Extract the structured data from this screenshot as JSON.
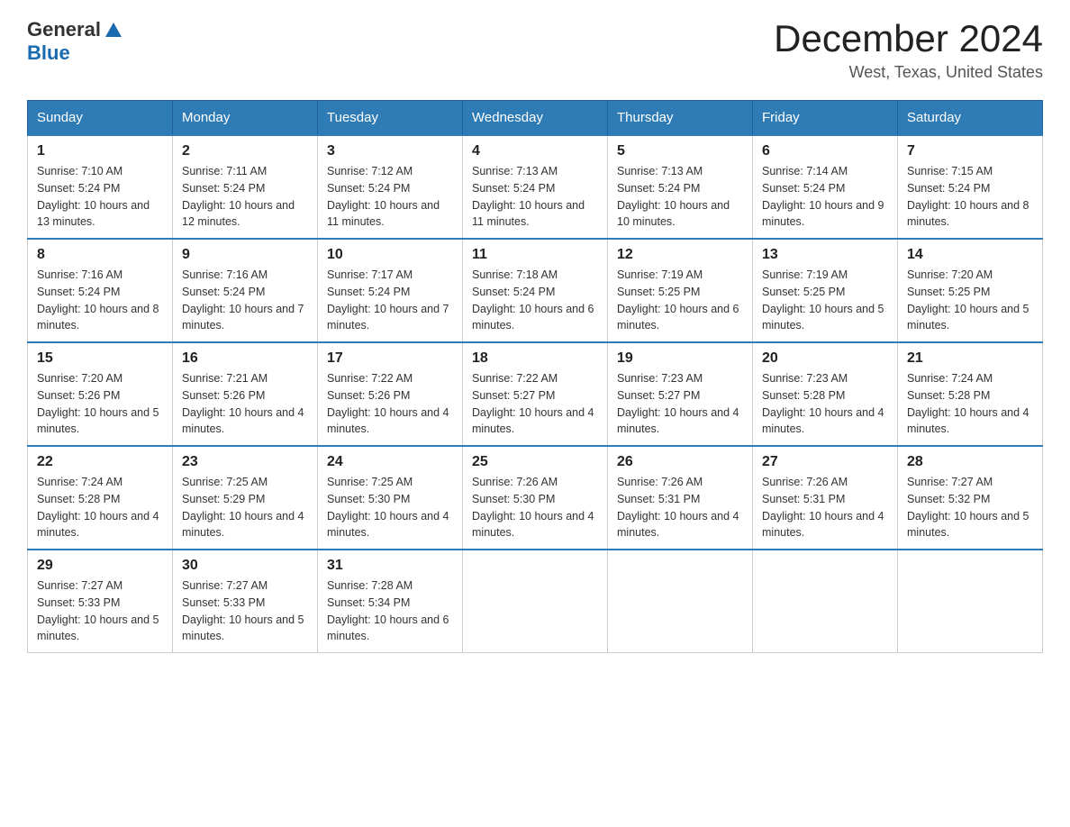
{
  "header": {
    "logo": {
      "general": "General",
      "blue": "Blue"
    },
    "title": "December 2024",
    "subtitle": "West, Texas, United States"
  },
  "weekdays": [
    "Sunday",
    "Monday",
    "Tuesday",
    "Wednesday",
    "Thursday",
    "Friday",
    "Saturday"
  ],
  "weeks": [
    [
      {
        "day": "1",
        "sunrise": "7:10 AM",
        "sunset": "5:24 PM",
        "daylight": "10 hours and 13 minutes."
      },
      {
        "day": "2",
        "sunrise": "7:11 AM",
        "sunset": "5:24 PM",
        "daylight": "10 hours and 12 minutes."
      },
      {
        "day": "3",
        "sunrise": "7:12 AM",
        "sunset": "5:24 PM",
        "daylight": "10 hours and 11 minutes."
      },
      {
        "day": "4",
        "sunrise": "7:13 AM",
        "sunset": "5:24 PM",
        "daylight": "10 hours and 11 minutes."
      },
      {
        "day": "5",
        "sunrise": "7:13 AM",
        "sunset": "5:24 PM",
        "daylight": "10 hours and 10 minutes."
      },
      {
        "day": "6",
        "sunrise": "7:14 AM",
        "sunset": "5:24 PM",
        "daylight": "10 hours and 9 minutes."
      },
      {
        "day": "7",
        "sunrise": "7:15 AM",
        "sunset": "5:24 PM",
        "daylight": "10 hours and 8 minutes."
      }
    ],
    [
      {
        "day": "8",
        "sunrise": "7:16 AM",
        "sunset": "5:24 PM",
        "daylight": "10 hours and 8 minutes."
      },
      {
        "day": "9",
        "sunrise": "7:16 AM",
        "sunset": "5:24 PM",
        "daylight": "10 hours and 7 minutes."
      },
      {
        "day": "10",
        "sunrise": "7:17 AM",
        "sunset": "5:24 PM",
        "daylight": "10 hours and 7 minutes."
      },
      {
        "day": "11",
        "sunrise": "7:18 AM",
        "sunset": "5:24 PM",
        "daylight": "10 hours and 6 minutes."
      },
      {
        "day": "12",
        "sunrise": "7:19 AM",
        "sunset": "5:25 PM",
        "daylight": "10 hours and 6 minutes."
      },
      {
        "day": "13",
        "sunrise": "7:19 AM",
        "sunset": "5:25 PM",
        "daylight": "10 hours and 5 minutes."
      },
      {
        "day": "14",
        "sunrise": "7:20 AM",
        "sunset": "5:25 PM",
        "daylight": "10 hours and 5 minutes."
      }
    ],
    [
      {
        "day": "15",
        "sunrise": "7:20 AM",
        "sunset": "5:26 PM",
        "daylight": "10 hours and 5 minutes."
      },
      {
        "day": "16",
        "sunrise": "7:21 AM",
        "sunset": "5:26 PM",
        "daylight": "10 hours and 4 minutes."
      },
      {
        "day": "17",
        "sunrise": "7:22 AM",
        "sunset": "5:26 PM",
        "daylight": "10 hours and 4 minutes."
      },
      {
        "day": "18",
        "sunrise": "7:22 AM",
        "sunset": "5:27 PM",
        "daylight": "10 hours and 4 minutes."
      },
      {
        "day": "19",
        "sunrise": "7:23 AM",
        "sunset": "5:27 PM",
        "daylight": "10 hours and 4 minutes."
      },
      {
        "day": "20",
        "sunrise": "7:23 AM",
        "sunset": "5:28 PM",
        "daylight": "10 hours and 4 minutes."
      },
      {
        "day": "21",
        "sunrise": "7:24 AM",
        "sunset": "5:28 PM",
        "daylight": "10 hours and 4 minutes."
      }
    ],
    [
      {
        "day": "22",
        "sunrise": "7:24 AM",
        "sunset": "5:28 PM",
        "daylight": "10 hours and 4 minutes."
      },
      {
        "day": "23",
        "sunrise": "7:25 AM",
        "sunset": "5:29 PM",
        "daylight": "10 hours and 4 minutes."
      },
      {
        "day": "24",
        "sunrise": "7:25 AM",
        "sunset": "5:30 PM",
        "daylight": "10 hours and 4 minutes."
      },
      {
        "day": "25",
        "sunrise": "7:26 AM",
        "sunset": "5:30 PM",
        "daylight": "10 hours and 4 minutes."
      },
      {
        "day": "26",
        "sunrise": "7:26 AM",
        "sunset": "5:31 PM",
        "daylight": "10 hours and 4 minutes."
      },
      {
        "day": "27",
        "sunrise": "7:26 AM",
        "sunset": "5:31 PM",
        "daylight": "10 hours and 4 minutes."
      },
      {
        "day": "28",
        "sunrise": "7:27 AM",
        "sunset": "5:32 PM",
        "daylight": "10 hours and 5 minutes."
      }
    ],
    [
      {
        "day": "29",
        "sunrise": "7:27 AM",
        "sunset": "5:33 PM",
        "daylight": "10 hours and 5 minutes."
      },
      {
        "day": "30",
        "sunrise": "7:27 AM",
        "sunset": "5:33 PM",
        "daylight": "10 hours and 5 minutes."
      },
      {
        "day": "31",
        "sunrise": "7:28 AM",
        "sunset": "5:34 PM",
        "daylight": "10 hours and 6 minutes."
      },
      null,
      null,
      null,
      null
    ]
  ]
}
